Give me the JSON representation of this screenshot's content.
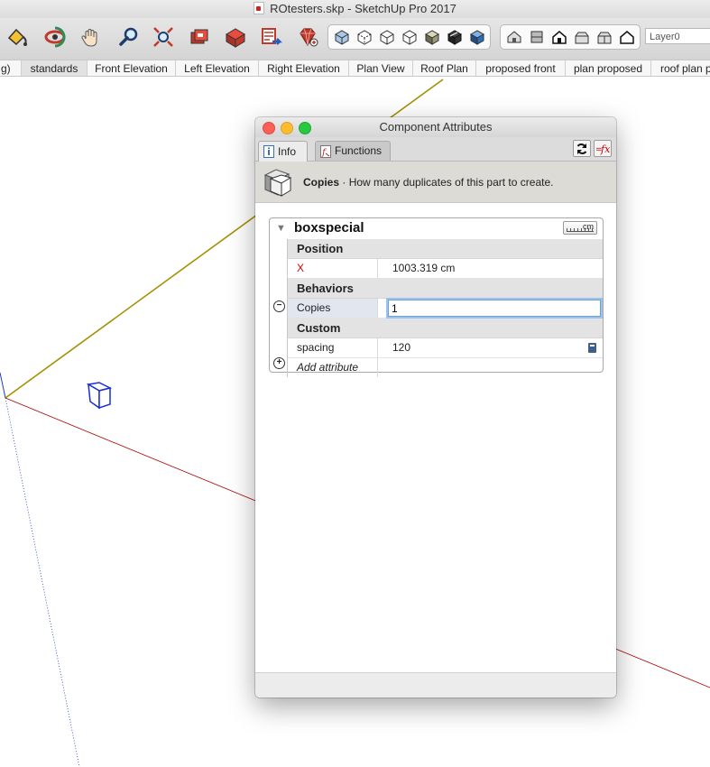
{
  "window": {
    "title": "ROtesters.skp - SketchUp Pro 2017"
  },
  "toolbar": {
    "tools": [
      "paint-bucket-icon",
      "orbit-icon",
      "pan-hand-icon",
      "zoom-icon",
      "zoom-extents-icon",
      "components-icon",
      "3d-warehouse-icon",
      "share-model-icon",
      "ruby-extension-icon"
    ],
    "view_styles": [
      "xray-style-icon",
      "back-edges-style-icon",
      "wireframe-style-icon",
      "hidden-line-style-icon",
      "shaded-style-icon",
      "shaded-textures-style-icon",
      "monochrome-style-icon"
    ],
    "views": [
      "iso-view-icon",
      "top-view-icon",
      "front-view-icon",
      "right-view-icon",
      "back-view-icon",
      "left-view-icon"
    ],
    "layer_value": "Layer0"
  },
  "scenes": [
    "g)",
    "standards",
    "Front Elevation",
    "Left Elevation",
    "Right Elevation",
    "Plan View",
    "Roof Plan",
    "proposed front",
    "plan proposed",
    "roof plan p"
  ],
  "dialog": {
    "title": "Component Attributes",
    "tabs": {
      "info": "Info",
      "functions": "Functions"
    },
    "info_header": {
      "attribute": "Copies",
      "separator": " · ",
      "description": "How many duplicates of this part to create."
    },
    "component": {
      "name": "boxspecial",
      "unit": "cm"
    },
    "sections": {
      "position": "Position",
      "behaviors": "Behaviors",
      "custom": "Custom"
    },
    "rows": {
      "x": {
        "key": "X",
        "value": "1003.319 cm"
      },
      "copies": {
        "key": "Copies",
        "value": "1"
      },
      "spacing": {
        "key": "spacing",
        "value": "120"
      }
    },
    "add_attribute": "Add attribute",
    "remove_symbol": "⊖",
    "add_symbol": "⊕"
  }
}
